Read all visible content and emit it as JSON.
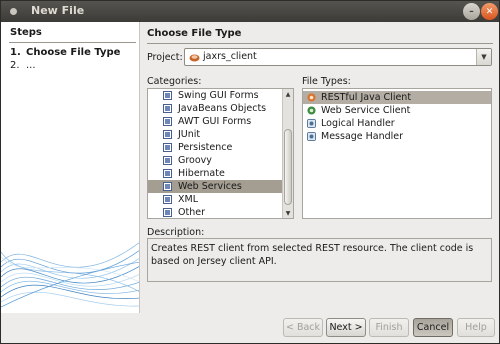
{
  "window": {
    "title": "New File"
  },
  "steps": {
    "heading": "Steps",
    "items": [
      {
        "number": "1.",
        "label": "Choose File Type"
      },
      {
        "number": "2.",
        "label": "..."
      }
    ]
  },
  "main": {
    "heading": "Choose File Type",
    "project": {
      "label": "Project:",
      "value": "jaxrs_client"
    },
    "categories": {
      "label": "Categories:",
      "items": [
        "Swing GUI Forms",
        "JavaBeans Objects",
        "AWT GUI Forms",
        "JUnit",
        "Persistence",
        "Groovy",
        "Hibernate",
        "Web Services",
        "XML",
        "Other"
      ],
      "selected": "Web Services"
    },
    "file_types": {
      "label": "File Types:",
      "items": [
        "RESTful Java Client",
        "Web Service Client",
        "Logical Handler",
        "Message Handler"
      ],
      "selected": "RESTful Java Client"
    },
    "description": {
      "label": "Description:",
      "text": "Creates REST client from selected REST resource. The client code is based on Jersey client API."
    }
  },
  "buttons": {
    "back": "< Back",
    "next": "Next >",
    "finish": "Finish",
    "cancel": "Cancel",
    "help": "Help"
  }
}
